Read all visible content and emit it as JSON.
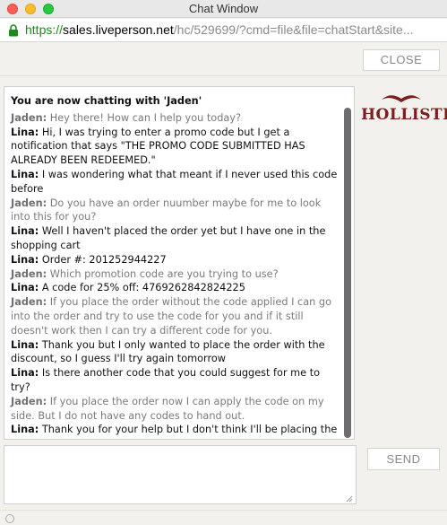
{
  "window": {
    "title": "Chat Window"
  },
  "address_bar": {
    "scheme": "https://",
    "host": "sales.liveperson.net",
    "rest": "/hc/529699/?cmd=file&file=chatStart&site..."
  },
  "toolbar": {
    "close_label": "CLOSE"
  },
  "brand": {
    "name": "HOLLISTER",
    "color": "#7a1f1d"
  },
  "chat": {
    "header": "You are now chatting with 'Jaden'",
    "messages": [
      {
        "role": "agent",
        "who": "Jaden:",
        "text": "Hey there! How can I help you today?"
      },
      {
        "role": "visitor",
        "who": "Lina:",
        "text": "Hi, I was trying to enter a promo code but I get a notification that says \"THE PROMO CODE SUBMITTED HAS ALREADY BEEN REDEEMED.\""
      },
      {
        "role": "visitor",
        "who": "Lina:",
        "text": "I was wondering what that meant if I never used this code before"
      },
      {
        "role": "agent",
        "who": "Jaden:",
        "text": "Do you have an order nuumber maybe for me to look into this for you?"
      },
      {
        "role": "visitor",
        "who": "Lina:",
        "text": "Well I haven't placed the order yet but I have one in the shopping cart"
      },
      {
        "role": "visitor",
        "who": "Lina:",
        "text": "Order #: 201252944227"
      },
      {
        "role": "agent",
        "who": "Jaden:",
        "text": "Which promotion code are you trying to use?"
      },
      {
        "role": "visitor",
        "who": "Lina:",
        "text": "A code for 25% off: 4769262842824225"
      },
      {
        "role": "agent",
        "who": "Jaden:",
        "text": "If you place the order without the code applied I can go into the order and try to use the code for you and if it still doesn't work then I can try a different code for you."
      },
      {
        "role": "visitor",
        "who": "Lina:",
        "text": "Thank you but I only wanted to place the order with the discount, so I guess I'll try again tomorrow"
      },
      {
        "role": "visitor",
        "who": "Lina:",
        "text": "Is there another code that you could suggest for me to try?"
      },
      {
        "role": "agent",
        "who": "Jaden:",
        "text": "If you place the order now I can apply the code on my side. But I do not have any codes to hand out."
      },
      {
        "role": "visitor",
        "who": "Lina:",
        "text": "Thank you for your help but I don't think I'll be placing the order today"
      }
    ]
  },
  "composer": {
    "value": "",
    "send_label": "SEND"
  }
}
